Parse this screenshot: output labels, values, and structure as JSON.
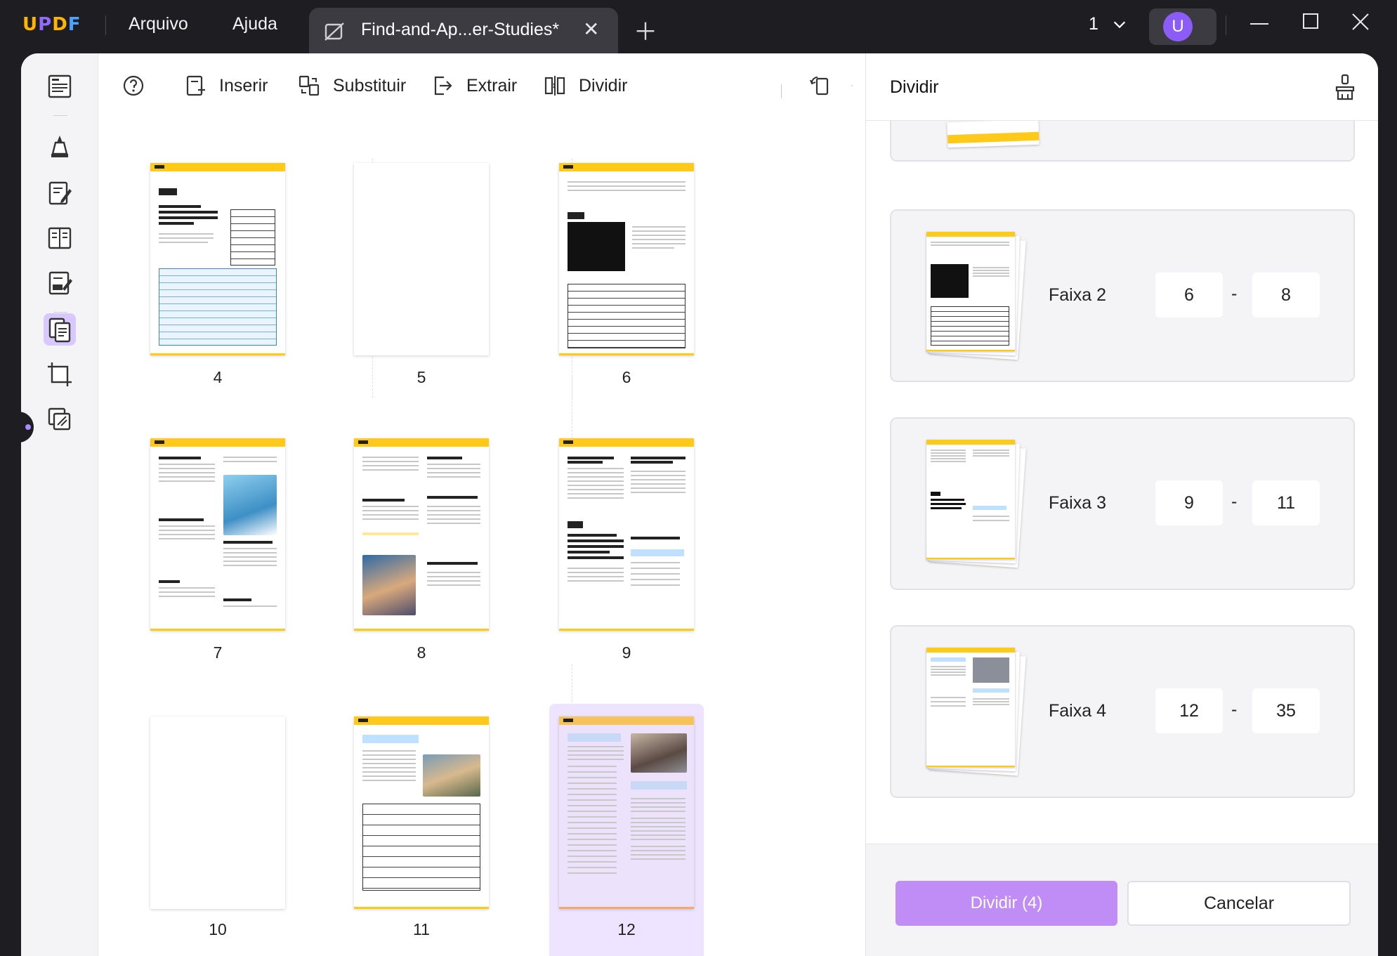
{
  "app": {
    "logo": "UPDF"
  },
  "menu": {
    "file": "Arquivo",
    "help": "Ajuda"
  },
  "tab": {
    "title": "Find-and-Ap...er-Studies*"
  },
  "titlebar": {
    "page_count": "1",
    "user_initial": "U"
  },
  "toolbar": {
    "insert": "Inserir",
    "replace": "Substituir",
    "extract": "Extrair",
    "split": "Dividir"
  },
  "pages": [
    {
      "number": "4"
    },
    {
      "number": "5"
    },
    {
      "number": "6"
    },
    {
      "number": "7"
    },
    {
      "number": "8"
    },
    {
      "number": "9"
    },
    {
      "number": "10"
    },
    {
      "number": "11"
    },
    {
      "number": "12"
    }
  ],
  "panel": {
    "title": "Dividir",
    "ranges": [
      {
        "label": "Faixa 2",
        "from": "6",
        "to": "8"
      },
      {
        "label": "Faixa 3",
        "from": "9",
        "to": "11"
      },
      {
        "label": "Faixa 4",
        "from": "12",
        "to": "35"
      }
    ],
    "separator": "-",
    "split_button": "Dividir (4)",
    "cancel_button": "Cancelar"
  },
  "colors": {
    "accent": "#c08cf6",
    "page_header": "#ffc91a",
    "selected_page": "#eee4ff"
  }
}
